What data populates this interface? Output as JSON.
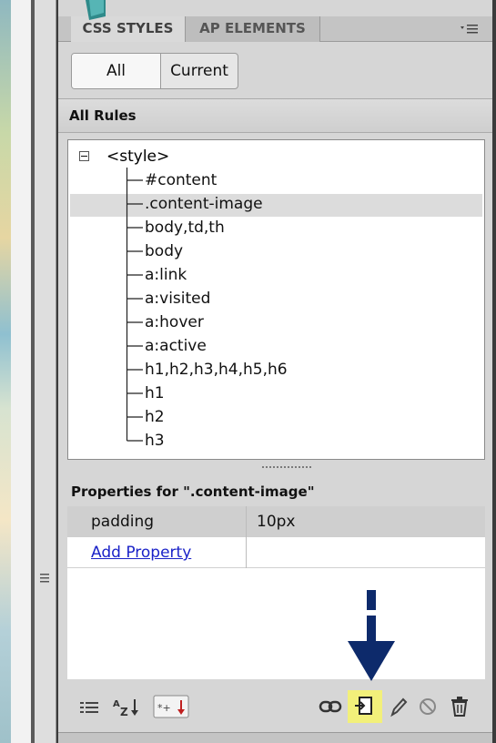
{
  "panel": {
    "tabs": [
      {
        "label": "CSS STYLES",
        "active": true
      },
      {
        "label": "AP ELEMENTS",
        "active": false
      }
    ],
    "menu_icon": "panel-options-icon"
  },
  "view_toggle": {
    "all_label": "All",
    "current_label": "Current",
    "selected": "All"
  },
  "all_rules": {
    "header": "All Rules",
    "root": "<style>",
    "rules": [
      "#content",
      ".content-image",
      "body,td,th",
      "body",
      "a:link",
      "a:visited",
      "a:hover",
      "a:active",
      "h1,h2,h3,h4,h5,h6",
      "h1",
      "h2",
      "h3"
    ],
    "selected_rule": ".content-image"
  },
  "properties": {
    "header": "Properties for \".content-image\"",
    "rows": [
      {
        "name": "padding",
        "value": "10px"
      }
    ],
    "add_property_label": "Add Property"
  },
  "toolbar": {
    "icons": [
      "category-view-icon",
      "alphabetical-view-icon",
      "set-properties-view-icon",
      "attach-stylesheet-icon",
      "new-css-rule-icon",
      "edit-rule-icon",
      "disable-property-icon",
      "delete-rule-icon"
    ],
    "highlighted": "new-css-rule-icon",
    "highlight_color": "#f2f07a",
    "arrow_color": "#0d2a6b"
  }
}
